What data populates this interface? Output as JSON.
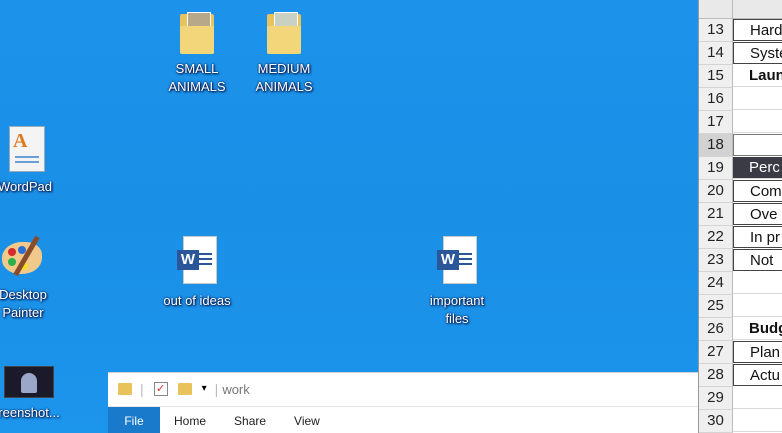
{
  "desktop": {
    "icons": [
      {
        "label": "SMALL\nANIMALS"
      },
      {
        "label": "MEDIUM\nANIMALS"
      },
      {
        "label": "WordPad"
      },
      {
        "label": "Desktop\nPainter"
      },
      {
        "label": "out of ideas"
      },
      {
        "label": "important\nfiles"
      },
      {
        "label": "reenshot..."
      }
    ]
  },
  "explorer": {
    "title": "work",
    "tabs": [
      "File",
      "Home",
      "Share",
      "View"
    ]
  },
  "sheet": {
    "rows": [
      {
        "num": "13",
        "text": "Hard"
      },
      {
        "num": "14",
        "text": "Syste"
      },
      {
        "num": "15",
        "text": "Laun"
      },
      {
        "num": "16",
        "text": ""
      },
      {
        "num": "17",
        "text": ""
      },
      {
        "num": "18",
        "text": ""
      },
      {
        "num": "19",
        "text": "Perc"
      },
      {
        "num": "20",
        "text": "Com"
      },
      {
        "num": "21",
        "text": "Ove"
      },
      {
        "num": "22",
        "text": "In pr"
      },
      {
        "num": "23",
        "text": "Not"
      },
      {
        "num": "24",
        "text": ""
      },
      {
        "num": "25",
        "text": ""
      },
      {
        "num": "26",
        "text": "Budg"
      },
      {
        "num": "27",
        "text": "Plan"
      },
      {
        "num": "28",
        "text": "Actu"
      },
      {
        "num": "29",
        "text": ""
      },
      {
        "num": "30",
        "text": ""
      }
    ]
  }
}
